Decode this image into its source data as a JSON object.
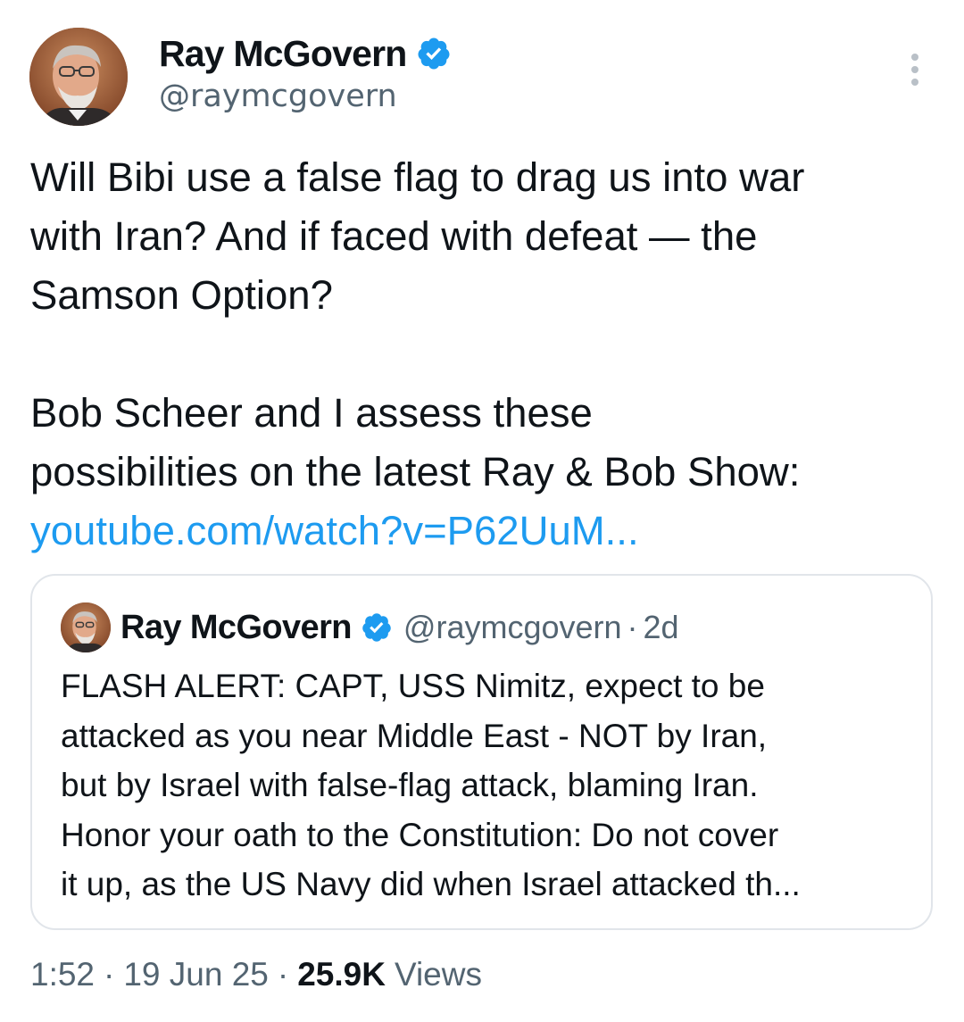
{
  "author": {
    "display_name": "Ray McGovern",
    "handle": "@raymcgovern",
    "verified": true
  },
  "tweet": {
    "lines": [
      "Will Bibi use a false flag to drag us into war",
      "with Iran? And if faced with defeat — the",
      "Samson Option?",
      "",
      "Bob Scheer and I assess these",
      "possibilities on the latest Ray & Bob Show:"
    ],
    "link_text": "youtube.com/watch?v=P62UuM..."
  },
  "quoted_tweet": {
    "display_name": "Ray McGovern",
    "handle": "@raymcgovern",
    "separator": "·",
    "time": "2d",
    "lines": [
      "FLASH ALERT: CAPT, USS Nimitz, expect to be",
      "attacked as you near Middle East - NOT by Iran,",
      "but by Israel with false-flag attack, blaming Iran.",
      "Honor your oath to the Constitution: Do not cover",
      "it up, as the US Navy did when Israel attacked th..."
    ]
  },
  "meta": {
    "time": "1:52",
    "separator": "·",
    "date": "19 Jun 25",
    "views_count": "25.9K",
    "views_label": "Views"
  },
  "icons": {
    "verified": "verified-badge-icon",
    "more": "more-options-icon"
  },
  "colors": {
    "link": "#1d9bf0",
    "verified": "#1d9bf0",
    "secondary_text": "#536471",
    "primary_text": "#0f1419",
    "card_border": "#e1e5ea"
  }
}
